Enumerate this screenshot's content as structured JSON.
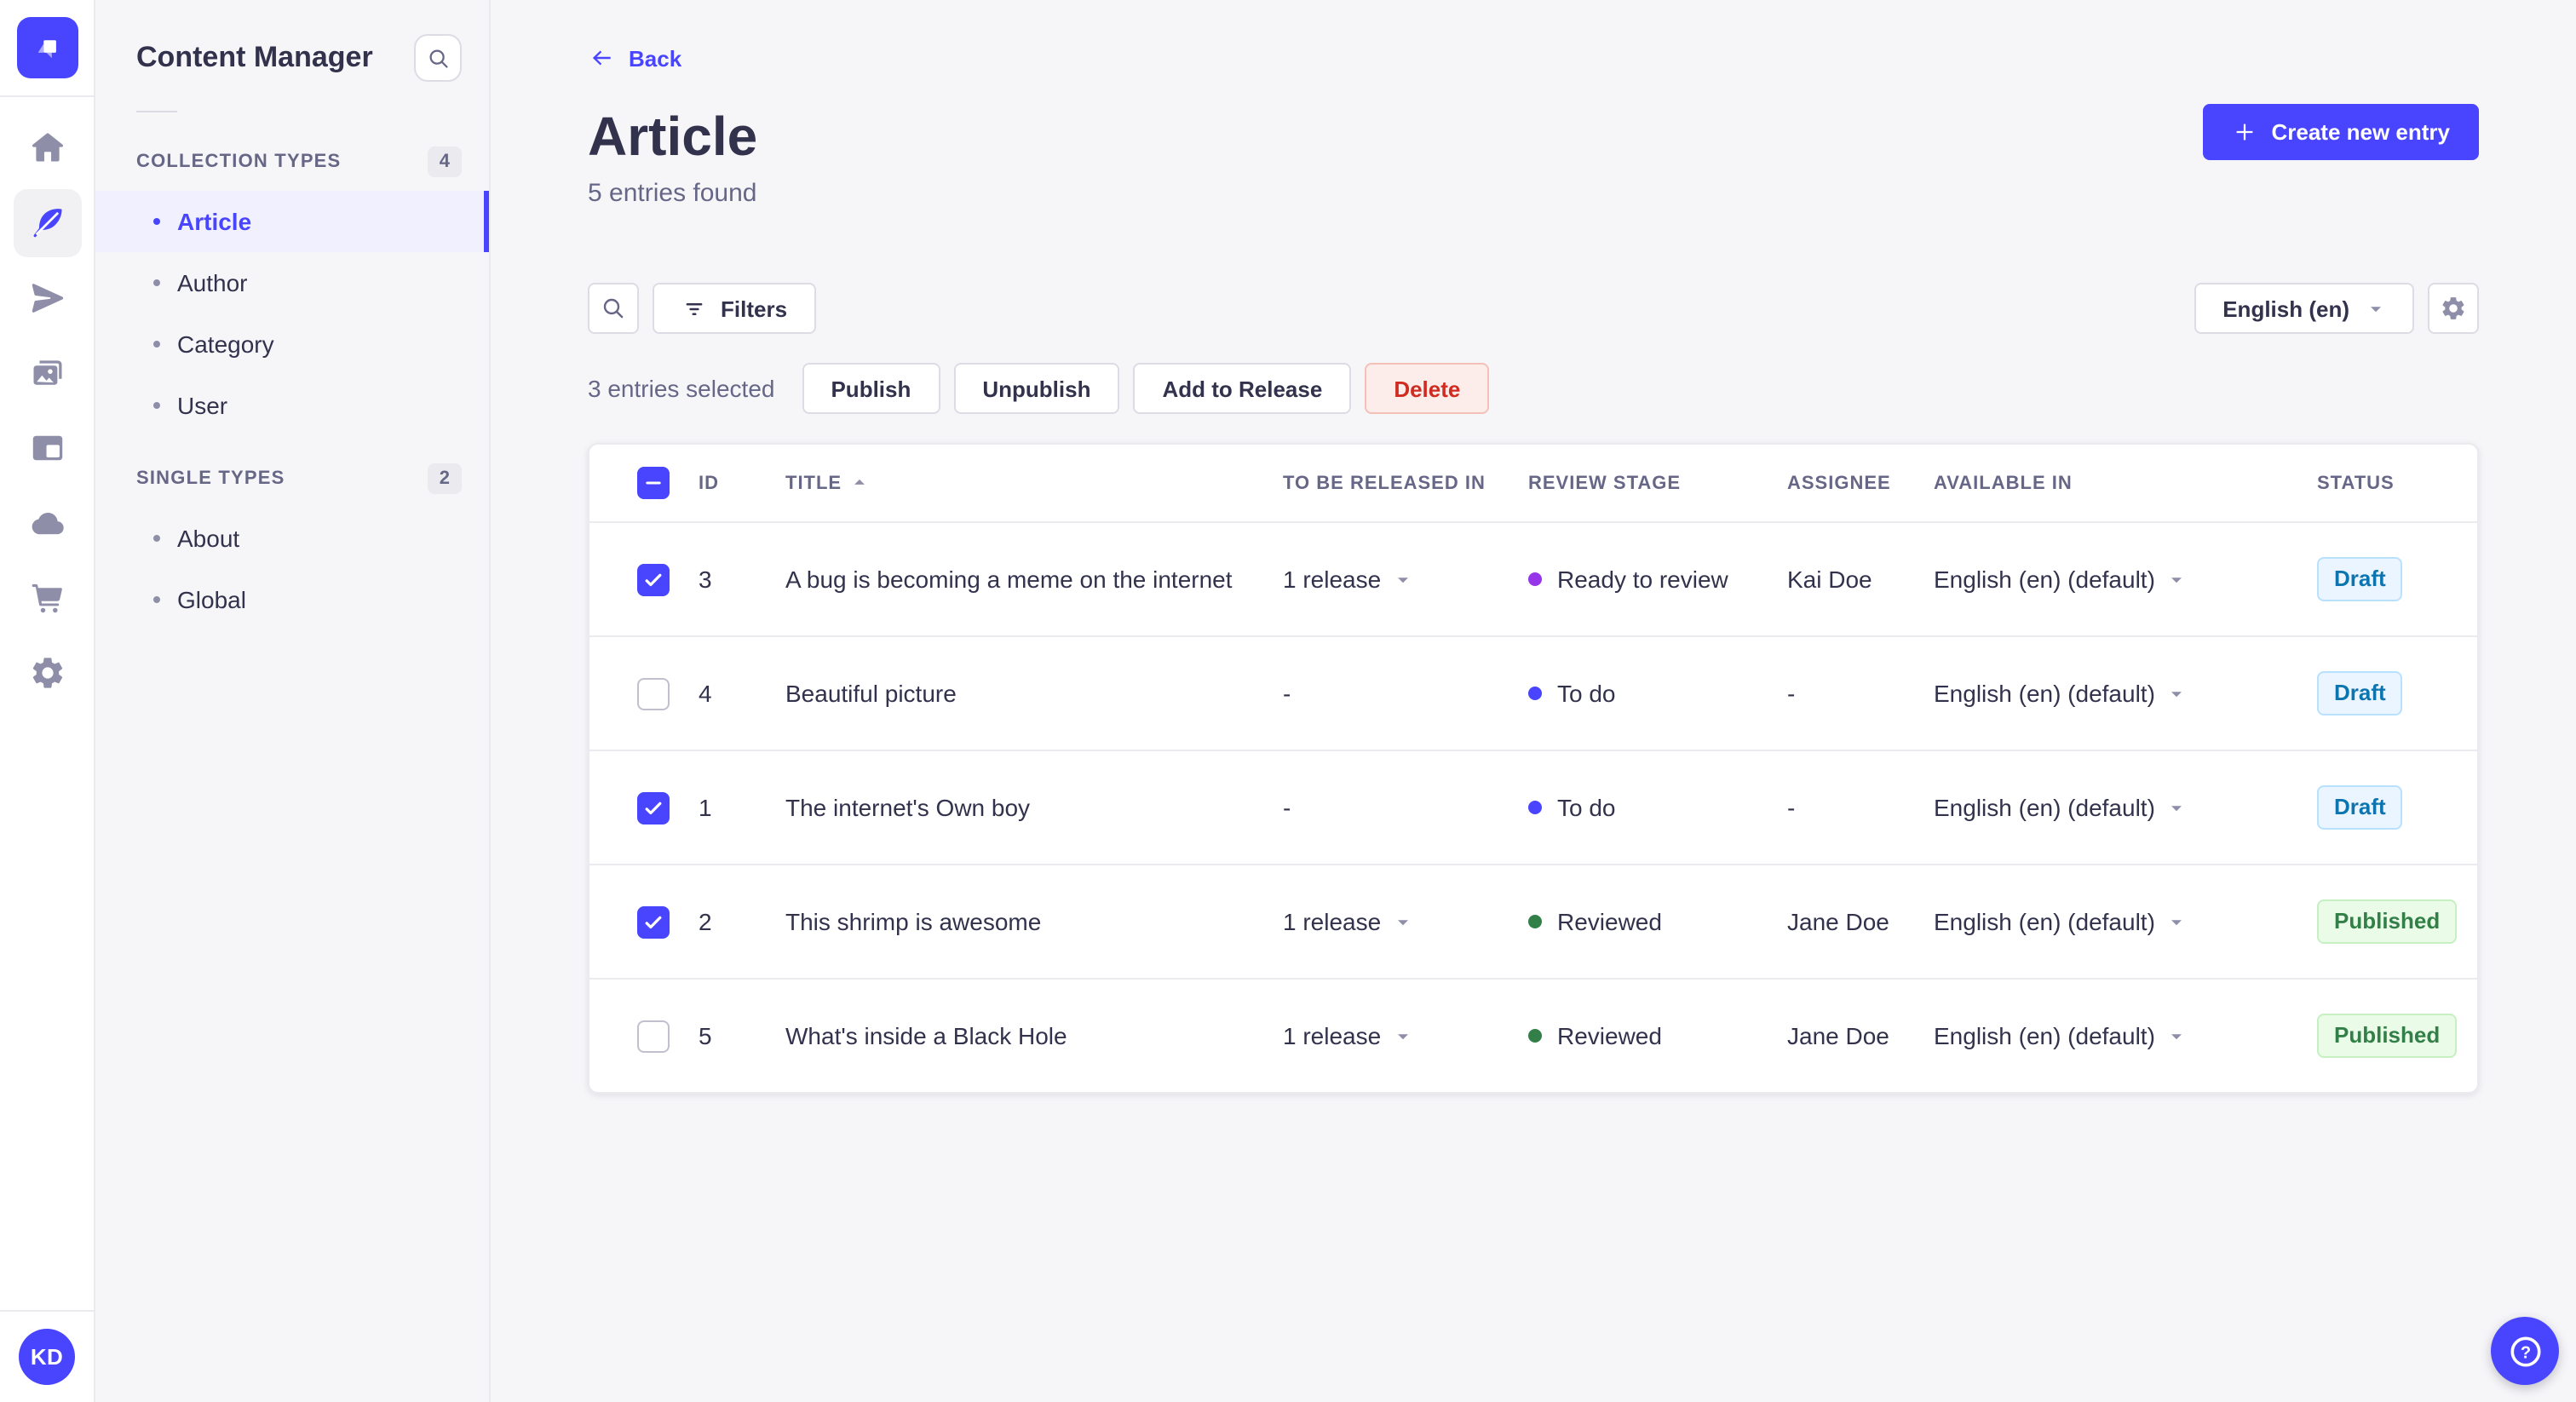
{
  "colors": {
    "primary": "#4945ff",
    "primary_light": "#f0f0ff",
    "danger_text": "#d02b20",
    "danger_bg": "#fcecea",
    "draft_text": "#0c75af",
    "draft_bg": "#eaf5ff",
    "published_text": "#328048",
    "published_bg": "#eafbe7",
    "stage_todo": "#4945ff",
    "stage_ready": "#9736e8",
    "stage_reviewed": "#328048"
  },
  "rail": {
    "logo_icon": "strapi-logo",
    "items": [
      {
        "icon": "home-icon",
        "active": false
      },
      {
        "icon": "feather-pen-icon",
        "active": true
      },
      {
        "icon": "paper-plane-icon",
        "active": false
      },
      {
        "icon": "media-library-icon",
        "active": false
      },
      {
        "icon": "layout-icon",
        "active": false
      },
      {
        "icon": "cloud-icon",
        "active": false
      },
      {
        "icon": "cart-icon",
        "active": false
      },
      {
        "icon": "gear-icon",
        "active": false
      }
    ],
    "avatar_initials": "KD"
  },
  "sidebar": {
    "title": "Content Manager",
    "sections": [
      {
        "label": "COLLECTION TYPES",
        "badge": "4",
        "items": [
          {
            "label": "Article",
            "active": true
          },
          {
            "label": "Author",
            "active": false
          },
          {
            "label": "Category",
            "active": false
          },
          {
            "label": "User",
            "active": false
          }
        ]
      },
      {
        "label": "SINGLE TYPES",
        "badge": "2",
        "items": [
          {
            "label": "About",
            "active": false
          },
          {
            "label": "Global",
            "active": false
          }
        ]
      }
    ]
  },
  "header": {
    "back_label": "Back",
    "title": "Article",
    "subtitle": "5 entries found",
    "create_label": "Create new entry"
  },
  "toolbar": {
    "filters_label": "Filters",
    "locale_value": "English (en)"
  },
  "selection": {
    "text": "3 entries selected",
    "actions": [
      {
        "label": "Publish",
        "variant": "neutral"
      },
      {
        "label": "Unpublish",
        "variant": "neutral"
      },
      {
        "label": "Add to Release",
        "variant": "neutral"
      },
      {
        "label": "Delete",
        "variant": "danger"
      }
    ]
  },
  "table": {
    "header_checkbox": "indeterminate",
    "sort": {
      "column": "TITLE",
      "direction": "asc"
    },
    "columns": [
      "ID",
      "TITLE",
      "TO BE RELEASED IN",
      "REVIEW STAGE",
      "ASSIGNEE",
      "AVAILABLE IN",
      "STATUS"
    ],
    "rows": [
      {
        "checked": true,
        "id": "3",
        "title": "A bug is becoming a meme on the internet",
        "released": "1 release",
        "has_release_menu": true,
        "stage": "Ready to review",
        "stage_color": "#9736e8",
        "assignee": "Kai Doe",
        "locale": "English (en) (default)",
        "status": "Draft",
        "status_variant": "draft"
      },
      {
        "checked": false,
        "id": "4",
        "title": "Beautiful picture",
        "released": "-",
        "has_release_menu": false,
        "stage": "To do",
        "stage_color": "#4945ff",
        "assignee": "-",
        "locale": "English (en) (default)",
        "status": "Draft",
        "status_variant": "draft"
      },
      {
        "checked": true,
        "id": "1",
        "title": "The internet's Own boy",
        "released": "-",
        "has_release_menu": false,
        "stage": "To do",
        "stage_color": "#4945ff",
        "assignee": "-",
        "locale": "English (en) (default)",
        "status": "Draft",
        "status_variant": "draft"
      },
      {
        "checked": true,
        "id": "2",
        "title": "This shrimp is awesome",
        "released": "1 release",
        "has_release_menu": true,
        "stage": "Reviewed",
        "stage_color": "#328048",
        "assignee": "Jane Doe",
        "locale": "English (en) (default)",
        "status": "Published",
        "status_variant": "published"
      },
      {
        "checked": false,
        "id": "5",
        "title": "What's inside a Black Hole",
        "released": "1 release",
        "has_release_menu": true,
        "stage": "Reviewed",
        "stage_color": "#328048",
        "assignee": "Jane Doe",
        "locale": "English (en) (default)",
        "status": "Published",
        "status_variant": "published"
      }
    ]
  },
  "help": {
    "icon": "question-mark-icon"
  }
}
